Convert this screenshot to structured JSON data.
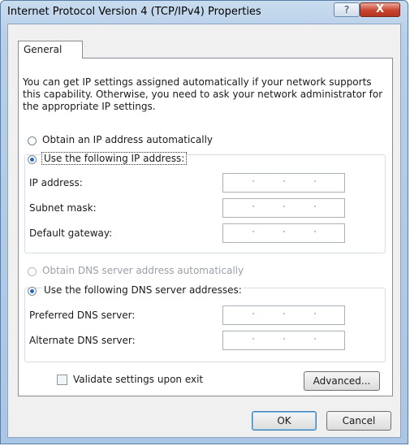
{
  "window": {
    "title": "Internet Protocol Version 4 (TCP/IPv4) Properties",
    "help_glyph": "?",
    "close_glyph": "X"
  },
  "tabs": [
    {
      "label": "General",
      "selected": true
    }
  ],
  "description": "You can get IP settings assigned automatically if your network supports this capability. Otherwise, you need to ask your network administrator for the appropriate IP settings.",
  "ip": {
    "auto_label": "Obtain an IP address automatically",
    "manual_label": "Use the following IP address:",
    "selected": "manual",
    "fields": [
      {
        "label": "IP address:",
        "value": ""
      },
      {
        "label": "Subnet mask:",
        "value": ""
      },
      {
        "label": "Default gateway:",
        "value": ""
      }
    ]
  },
  "dns": {
    "auto_label": "Obtain DNS server address automatically",
    "auto_enabled": false,
    "manual_label": "Use the following DNS server addresses:",
    "selected": "manual",
    "fields": [
      {
        "label": "Preferred DNS server:",
        "value": ""
      },
      {
        "label": "Alternate DNS server:",
        "value": ""
      }
    ]
  },
  "validate": {
    "label": "Validate settings upon exit",
    "checked": false
  },
  "buttons": {
    "advanced": "Advanced...",
    "ok": "OK",
    "cancel": "Cancel"
  },
  "colors": {
    "accent": "#1f6ac8",
    "close": "#c8432e",
    "titlebar": "#b7cfe8"
  }
}
